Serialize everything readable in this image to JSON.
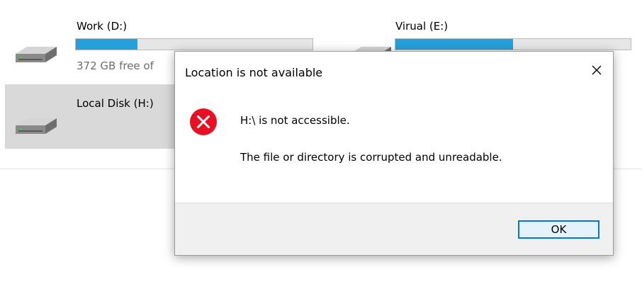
{
  "drives": {
    "d": {
      "name": "Work (D:)",
      "free_text": "372 GB free of",
      "used_fraction": 0.26
    },
    "e": {
      "name": "Virual (E:)",
      "used_fraction": 0.5
    },
    "h": {
      "name": "Local Disk (H:)"
    }
  },
  "dialog": {
    "title": "Location is not available",
    "close_glyph": "✕",
    "message_primary": "H:\\ is not accessible.",
    "message_secondary": "The file or directory is corrupted and unreadable.",
    "ok_label": "OK"
  },
  "colors": {
    "usage_bar_fill": "#26a0da",
    "error_icon": "#e81123",
    "selection": "#d9d9d9",
    "focus_border": "#0078d7"
  },
  "icons": {
    "drive": "hard-drive-icon",
    "error": "error-icon",
    "close": "close-icon"
  }
}
